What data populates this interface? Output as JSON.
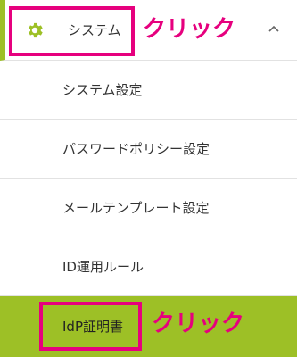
{
  "menu": {
    "header": {
      "label": "システム",
      "icon": "gear-icon",
      "toggle_icon": "chevron-up-icon"
    },
    "items": [
      {
        "label": "システム設定"
      },
      {
        "label": "パスワードポリシー設定"
      },
      {
        "label": "メールテンプレート設定"
      },
      {
        "label": "ID運用ルール"
      },
      {
        "label": "IdP証明書",
        "active": true
      }
    ]
  },
  "annotations": [
    {
      "text": "クリック",
      "target": "システム"
    },
    {
      "text": "クリック",
      "target": "IdP証明書"
    }
  ],
  "colors": {
    "accent_green": "#9dc026",
    "annotation_pink": "#e6007e",
    "divider": "#e2e2e2",
    "text": "#333333"
  }
}
